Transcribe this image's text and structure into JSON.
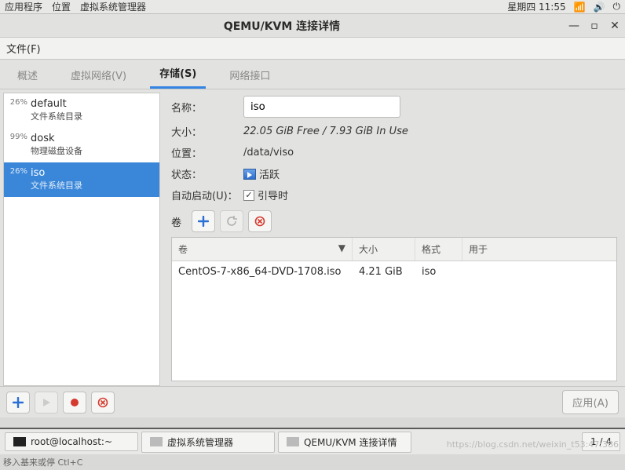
{
  "desktop": {
    "menu_items": [
      "应用程序",
      "位置",
      "虚拟系统管理器"
    ],
    "time": "星期四 11:55"
  },
  "window": {
    "title": "QEMU/KVM 连接详情"
  },
  "menubar": {
    "file": "文件(F)"
  },
  "tabs": {
    "overview": "概述",
    "vnet": "虚拟网络(V)",
    "storage": "存储(S)",
    "netif": "网络接口"
  },
  "pools": [
    {
      "pct": "26%",
      "name": "default",
      "sub": "文件系统目录"
    },
    {
      "pct": "99%",
      "name": "dosk",
      "sub": "物理磁盘设备"
    },
    {
      "pct": "26%",
      "name": "iso",
      "sub": "文件系统目录",
      "selected": true
    }
  ],
  "detail": {
    "labels": {
      "name": "名称：",
      "size": "大小：",
      "location": "位置：",
      "state": "状态：",
      "autostart": "自动启动(U)：",
      "volumes": "卷"
    },
    "name_value": "iso",
    "size_value": "22.05 GiB Free / 7.93 GiB In Use",
    "location_value": "/data/viso",
    "state_value": "活跃",
    "autostart_value": "引导时"
  },
  "vol_table": {
    "headers": {
      "vol": "卷",
      "size": "大小",
      "format": "格式",
      "used": "用于"
    },
    "rows": [
      {
        "vol": "CentOS-7-x86_64-DVD-1708.iso",
        "size": "4.21 GiB",
        "format": "iso",
        "used": ""
      }
    ]
  },
  "footer": {
    "apply": "应用(A)"
  },
  "taskbar": {
    "term": "root@localhost:~",
    "vmm": "虚拟系统管理器",
    "conn": "QEMU/KVM 连接详情",
    "pager": "1 / 4"
  },
  "watermark": "https://blog.csdn.net/weixin_t53:47:386",
  "statusline": "移入基来或停 Ctl+C"
}
